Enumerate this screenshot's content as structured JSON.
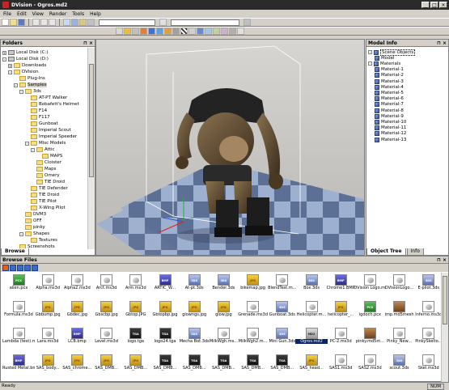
{
  "window": {
    "title": "DVision - Ogros.md2",
    "buttons": [
      "_",
      "□",
      "×"
    ]
  },
  "menu": [
    "File",
    "Edit",
    "View",
    "Render",
    "Tools",
    "Help"
  ],
  "toolbar": {
    "combo_left": "",
    "combo_right": ""
  },
  "folders": {
    "title": "Folders",
    "items": [
      {
        "label": "Local Disk (C:)",
        "indent": 1,
        "expander": "+"
      },
      {
        "label": "Local Disk (D:)",
        "indent": 1,
        "expander": "-"
      },
      {
        "label": "Downloads",
        "indent": 2,
        "expander": "+"
      },
      {
        "label": "DVision",
        "indent": 2,
        "expander": "-"
      },
      {
        "label": "Plug-Ins",
        "indent": 3,
        "expander": ""
      },
      {
        "label": "Samples",
        "indent": 3,
        "expander": "-"
      },
      {
        "label": "3ds",
        "indent": 4,
        "expander": "-"
      },
      {
        "label": "AT-PT Walker",
        "indent": 5,
        "expander": ""
      },
      {
        "label": "Bobafett's Helmet",
        "indent": 5,
        "expander": ""
      },
      {
        "label": "F14",
        "indent": 5,
        "expander": ""
      },
      {
        "label": "F117",
        "indent": 5,
        "expander": ""
      },
      {
        "label": "Gunboat",
        "indent": 5,
        "expander": ""
      },
      {
        "label": "Imperial Scout",
        "indent": 5,
        "expander": ""
      },
      {
        "label": "Imperial Speeder",
        "indent": 5,
        "expander": ""
      },
      {
        "label": "Misc Models",
        "indent": 5,
        "expander": "-"
      },
      {
        "label": "Attic",
        "indent": 6,
        "expander": "-"
      },
      {
        "label": "MAPS",
        "indent": 7,
        "expander": ""
      },
      {
        "label": "Cloister",
        "indent": 6,
        "expander": ""
      },
      {
        "label": "Maps",
        "indent": 6,
        "expander": ""
      },
      {
        "label": "Omery",
        "indent": 6,
        "expander": ""
      },
      {
        "label": "TIE Droid",
        "indent": 6,
        "expander": ""
      },
      {
        "label": "TIE Defender",
        "indent": 5,
        "expander": ""
      },
      {
        "label": "TIE Droid",
        "indent": 5,
        "expander": ""
      },
      {
        "label": "TIE Pilot",
        "indent": 5,
        "expander": ""
      },
      {
        "label": "X-Wing Pilot",
        "indent": 5,
        "expander": ""
      },
      {
        "label": "DVM3",
        "indent": 4,
        "expander": ""
      },
      {
        "label": "OFF",
        "indent": 4,
        "expander": ""
      },
      {
        "label": "pinky",
        "indent": 4,
        "expander": ""
      },
      {
        "label": "Shapes",
        "indent": 4,
        "expander": "-"
      },
      {
        "label": "Textures",
        "indent": 5,
        "expander": ""
      },
      {
        "label": "Screenshots",
        "indent": 3,
        "expander": ""
      }
    ],
    "tab": "Browse"
  },
  "model_info": {
    "title": "Model Info",
    "items": [
      {
        "label": "Scene Objects",
        "indent": 1,
        "selected": true
      },
      {
        "label": "Model",
        "indent": 2,
        "selected": false
      },
      {
        "label": "Materials",
        "indent": 1,
        "selected": false
      },
      {
        "label": "Material-1",
        "indent": 2,
        "selected": false
      },
      {
        "label": "Material-2",
        "indent": 2,
        "selected": false
      },
      {
        "label": "Material-3",
        "indent": 2,
        "selected": false
      },
      {
        "label": "Material-4",
        "indent": 2,
        "selected": false
      },
      {
        "label": "Material-5",
        "indent": 2,
        "selected": false
      },
      {
        "label": "Material-6",
        "indent": 2,
        "selected": false
      },
      {
        "label": "Material-7",
        "indent": 2,
        "selected": false
      },
      {
        "label": "Material-8",
        "indent": 2,
        "selected": false
      },
      {
        "label": "Material-9",
        "indent": 2,
        "selected": false
      },
      {
        "label": "Material-10",
        "indent": 2,
        "selected": false
      },
      {
        "label": "Material-11",
        "indent": 2,
        "selected": false
      },
      {
        "label": "Material-12",
        "indent": 2,
        "selected": false
      },
      {
        "label": "Material-13",
        "indent": 2,
        "selected": false
      }
    ],
    "tabs": [
      "Object Tree",
      "Info"
    ]
  },
  "browse_files": {
    "title": "Browse Files",
    "files": [
      {
        "name": "alien.pcx",
        "type": "pcx",
        "tag": "PCX"
      },
      {
        "name": "Alpha.ms3d",
        "type": "ms3d",
        "tag": ""
      },
      {
        "name": "Alpha2.ms3d",
        "type": "ms3d",
        "tag": ""
      },
      {
        "name": "Arct.ms3d",
        "type": "ms3d",
        "tag": ""
      },
      {
        "name": "Arm.ms3d",
        "type": "ms3d",
        "tag": ""
      },
      {
        "name": "ARTIC_W...",
        "type": "bmp",
        "tag": "BMP"
      },
      {
        "name": "At-pt.3ds",
        "type": "3ds",
        "tag": "3DS"
      },
      {
        "name": "Bender.3ds",
        "type": "3ds",
        "tag": "3DS"
      },
      {
        "name": "bikemap.jpg",
        "type": "jpg",
        "tag": "JPG"
      },
      {
        "name": "BlendTest.m...",
        "type": "ms3d",
        "tag": ""
      },
      {
        "name": "Box.3ds",
        "type": "3ds",
        "tag": "3DS"
      },
      {
        "name": "Chrome1.BMP",
        "type": "bmp",
        "tag": "BMP"
      },
      {
        "name": "DVision Logo.ms3d",
        "type": "ms3d",
        "tag": ""
      },
      {
        "name": "DVisionLogo...",
        "type": "ms3d",
        "tag": ""
      },
      {
        "name": "E-pilot.3ds",
        "type": "3ds",
        "tag": "3DS"
      },
      {
        "name": "Formula.ms3d",
        "type": "ms3d",
        "tag": ""
      },
      {
        "name": "Gbbump.jpg",
        "type": "jpg",
        "tag": "JPG"
      },
      {
        "name": "Gbdec.jpg",
        "type": "jpg",
        "tag": "JPG"
      },
      {
        "name": "Gbscbp.jpg",
        "type": "jpg",
        "tag": "JPG"
      },
      {
        "name": "Gbtop.JPG",
        "type": "jpg",
        "tag": "JPG"
      },
      {
        "name": "Gbtopbp.jpg",
        "type": "jpg",
        "tag": "JPG"
      },
      {
        "name": "glowngs.jpg",
        "type": "jpg",
        "tag": "JPG"
      },
      {
        "name": "glow.jpg",
        "type": "jpg",
        "tag": "JPG"
      },
      {
        "name": "Grenade.ms3d",
        "type": "ms3d",
        "tag": ""
      },
      {
        "name": "Gunboat.3ds",
        "type": "3ds",
        "tag": "3DS"
      },
      {
        "name": "Helicopter.m...",
        "type": "ms3d",
        "tag": ""
      },
      {
        "name": "helicopter_...",
        "type": "jpg",
        "tag": "JPG"
      },
      {
        "name": "igdoch.pcx",
        "type": "pcx",
        "tag": "PCX"
      },
      {
        "name": "imp.md5mesh",
        "type": "mdl",
        "tag": ""
      },
      {
        "name": "Inferno.ms3d",
        "type": "ms3d",
        "tag": ""
      },
      {
        "name": "Lambda (test).ms3d",
        "type": "ms3d",
        "tag": ""
      },
      {
        "name": "Lara.ms3d",
        "type": "ms3d",
        "tag": ""
      },
      {
        "name": "LCB.bmp",
        "type": "bmp",
        "tag": "BMP"
      },
      {
        "name": "Level.ms3d",
        "type": "ms3d",
        "tag": ""
      },
      {
        "name": "logo.tga",
        "type": "tga",
        "tag": "TGA"
      },
      {
        "name": "logo24.tga",
        "type": "tga",
        "tag": "TGA"
      },
      {
        "name": "Mecha Bot.3ds",
        "type": "3ds",
        "tag": "3DS"
      },
      {
        "name": "MilkWgh.ms...",
        "type": "ms3d",
        "tag": ""
      },
      {
        "name": "MilkWgh2.m...",
        "type": "ms3d",
        "tag": ""
      },
      {
        "name": "Mini Gun.3ds",
        "type": "3ds",
        "tag": "3DS"
      },
      {
        "name": "Ogros.md2",
        "type": "md2",
        "tag": "MD2"
      },
      {
        "name": "PC-2.ms3d",
        "type": "ms3d",
        "tag": ""
      },
      {
        "name": "pinky.md5m...",
        "type": "mdl",
        "tag": ""
      },
      {
        "name": "Pinky_New...",
        "type": "ms3d",
        "tag": ""
      },
      {
        "name": "PinkySkelto...",
        "type": "ms3d",
        "tag": ""
      },
      {
        "name": "Rusted Metal.bmp",
        "type": "bmp",
        "tag": "BMP"
      },
      {
        "name": "SAS_body...",
        "type": "jpg",
        "tag": "JPG"
      },
      {
        "name": "SAS_chrome...",
        "type": "jpg",
        "tag": "JPG"
      },
      {
        "name": "SAS_DMB...",
        "type": "jpg",
        "tag": "JPG"
      },
      {
        "name": "SAS_DMB...",
        "type": "jpg",
        "tag": "JPG"
      },
      {
        "name": "SAS_DMB...",
        "type": "tga",
        "tag": "TGA"
      },
      {
        "name": "SAS_DMB...",
        "type": "tga",
        "tag": "TGA"
      },
      {
        "name": "SAS_DMB...",
        "type": "tga",
        "tag": "TGA"
      },
      {
        "name": "SAS_DMB...",
        "type": "tga",
        "tag": "TGA"
      },
      {
        "name": "SAS_DMB...",
        "type": "tga",
        "tag": "TGA"
      },
      {
        "name": "SAS_head...",
        "type": "jpg",
        "tag": "JPG"
      },
      {
        "name": "SAS1.ms3d",
        "type": "ms3d",
        "tag": ""
      },
      {
        "name": "SAS2.ms3d",
        "type": "ms3d",
        "tag": ""
      },
      {
        "name": "scout.3ds",
        "type": "3ds",
        "tag": "3DS"
      },
      {
        "name": "Skel.ms3d",
        "type": "ms3d",
        "tag": ""
      }
    ]
  },
  "status": {
    "text": "Ready",
    "indicator": "NUM"
  }
}
